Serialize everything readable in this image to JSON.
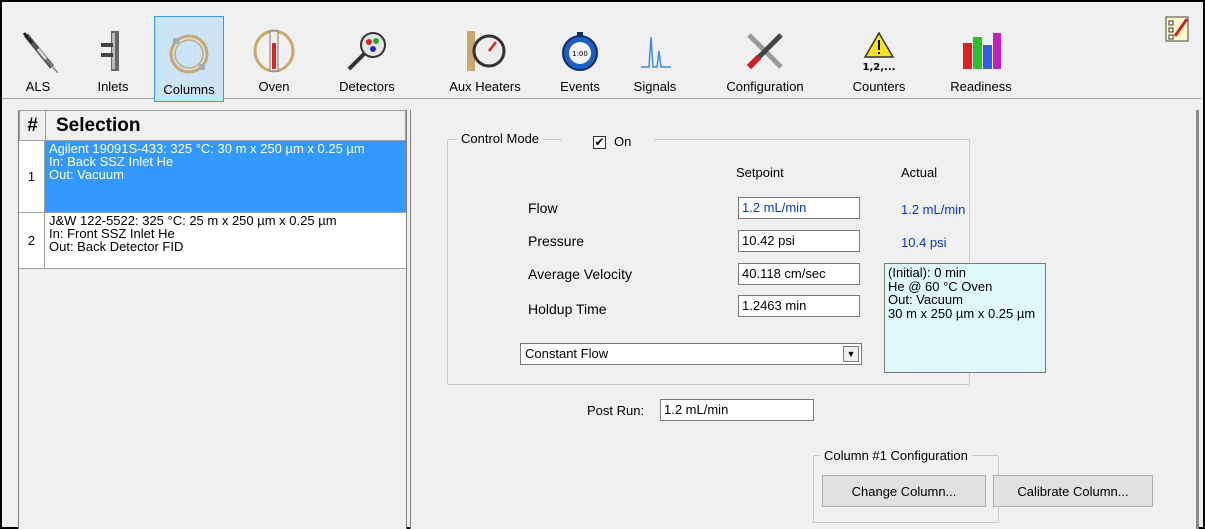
{
  "toolbar": {
    "items": [
      {
        "label": "ALS",
        "icon": "autosampler-syringe-icon"
      },
      {
        "label": "Inlets",
        "icon": "inlet-icon"
      },
      {
        "label": "Columns",
        "icon": "column-coil-icon",
        "selected": true
      },
      {
        "label": "Oven",
        "icon": "oven-icon"
      },
      {
        "label": "Detectors",
        "icon": "detector-icon"
      },
      {
        "label": "Aux Heaters",
        "icon": "gauge-icon"
      },
      {
        "label": "Events",
        "icon": "stopwatch-icon"
      },
      {
        "label": "Signals",
        "icon": "signal-peak-icon"
      },
      {
        "label": "Configuration",
        "icon": "tools-icon"
      },
      {
        "label": "Counters",
        "icon": "warning-counter-icon",
        "icon_text": "1,2,..."
      },
      {
        "label": "Readiness",
        "icon": "readiness-bars-icon"
      }
    ],
    "corner_icon": "checklist-edit-icon"
  },
  "column_list": {
    "header_num": "#",
    "header_selection": "Selection",
    "rows": [
      {
        "num": "1",
        "text": "Agilent 19091S-433: 325 °C: 30 m x 250 µm x 0.25 µm\nIn: Back SSZ Inlet He\nOut: Vacuum",
        "selected": true
      },
      {
        "num": "2",
        "text": "J&W 122-5522: 325 °C: 25 m x 250 µm x 0.25 µm\nIn: Front SSZ Inlet He\nOut: Back Detector FID",
        "selected": false
      }
    ]
  },
  "control": {
    "group_label": "Control Mode",
    "on_label": "On",
    "on_checked": true,
    "setpoint_header": "Setpoint",
    "actual_header": "Actual",
    "fields": [
      {
        "label": "Flow",
        "setpoint": "1.2 mL/min",
        "actual": "1.2 mL/min"
      },
      {
        "label": "Pressure",
        "setpoint": "10.42 psi",
        "actual": "10.4 psi"
      },
      {
        "label": "Average Velocity",
        "setpoint": "40.118 cm/sec"
      },
      {
        "label": "Holdup Time",
        "setpoint": "1.2463 min"
      }
    ],
    "info": "(Initial): 0 min\nHe @ 60 °C Oven\nOut: Vacuum\n30 m x 250 µm x 0.25 µm",
    "mode_selected": "Constant Flow"
  },
  "post_run": {
    "label": "Post Run:",
    "value": "1.2 mL/min"
  },
  "column_config": {
    "group_label": "Column #1 Configuration",
    "change_label": "Change Column...",
    "calibrate_label": "Calibrate Column..."
  },
  "colors": {
    "accent": "#3399ff",
    "actual_text": "#0b34d8",
    "info_bg": "#dff9fb"
  }
}
